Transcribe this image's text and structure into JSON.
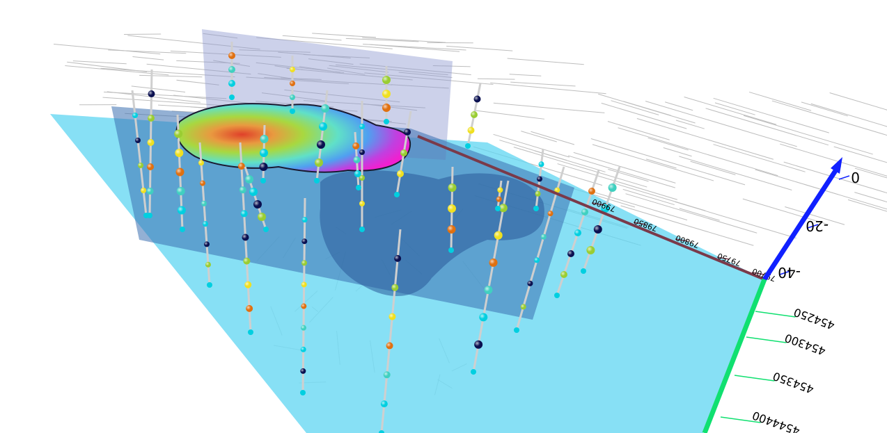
{
  "scene": {
    "colors": {
      "ground_plane": "#5fd6f2",
      "section_vertical": "#8f9ad0",
      "section_long": "#3a6fb0",
      "plume_shell": "#2a5a99",
      "street_lines": "#bdbdbd",
      "axis_z": "#1020ff",
      "axis_y": "#10e070",
      "axis_x": "#7a3a4a",
      "well_casing": "#cfcfcf"
    }
  },
  "axes": {
    "z_axis": {
      "ticks": [
        "0",
        "-20",
        "-40"
      ]
    },
    "y_axis": {
      "ticks": [
        "454250",
        "454300",
        "454350",
        "4544400"
      ]
    },
    "x_axis": {
      "ticks": [
        "79700",
        "79750",
        "79800",
        "79850",
        "79900"
      ]
    }
  },
  "sample_colors": [
    "#00cfe0",
    "#0a1050",
    "#9acd32",
    "#f0e020",
    "#e07010",
    "#40d0c0"
  ]
}
